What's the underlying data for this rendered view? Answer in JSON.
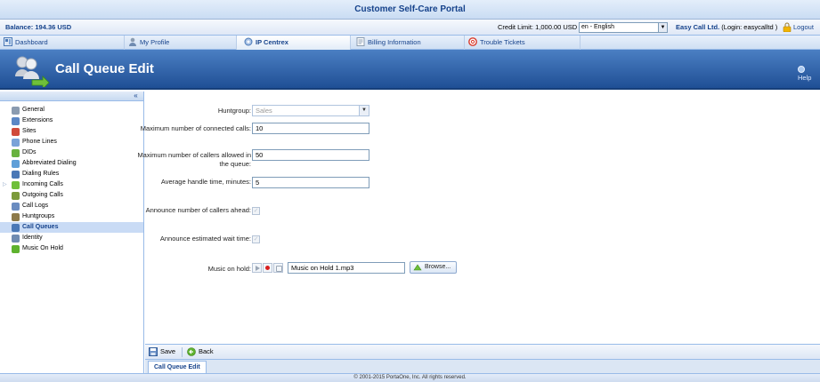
{
  "window": {
    "title": "Customer Self-Care Portal"
  },
  "status": {
    "balance": "Balance: 194.36 USD",
    "credit_limit_label": "Credit Limit:",
    "credit_limit_value": "1,000.00 USD",
    "language": "en - English",
    "company_name": "Easy Call Ltd.",
    "login": "(Login: easycalltd )",
    "logout": "Logout"
  },
  "tabs": [
    {
      "label": "Dashboard",
      "icon": "dashboard-icon",
      "active": false
    },
    {
      "label": "My Profile",
      "icon": "profile-icon",
      "active": false
    },
    {
      "label": "IP Centrex",
      "icon": "ip-centrex-icon",
      "active": true
    },
    {
      "label": "Billing Information",
      "icon": "billing-icon",
      "active": false
    },
    {
      "label": "Trouble Tickets",
      "icon": "lifebuoy-icon",
      "active": false
    }
  ],
  "page": {
    "title": "Call Queue Edit",
    "help": "Help"
  },
  "sidebar": {
    "items": [
      {
        "label": "General",
        "icon": "gear-icon",
        "selected": false,
        "expandable": false
      },
      {
        "label": "Extensions",
        "icon": "extensions-icon",
        "selected": false,
        "expandable": false
      },
      {
        "label": "Sites",
        "icon": "sites-icon",
        "selected": false,
        "expandable": false
      },
      {
        "label": "Phone Lines",
        "icon": "phone-lines-icon",
        "selected": false,
        "expandable": false
      },
      {
        "label": "DIDs",
        "icon": "dids-icon",
        "selected": false,
        "expandable": false
      },
      {
        "label": "Abbreviated Dialing",
        "icon": "abbreviated-dialing-icon",
        "selected": false,
        "expandable": false
      },
      {
        "label": "Dialing Rules",
        "icon": "dialing-rules-icon",
        "selected": false,
        "expandable": false
      },
      {
        "label": "Incoming Calls",
        "icon": "incoming-calls-icon",
        "selected": false,
        "expandable": true
      },
      {
        "label": "Outgoing Calls",
        "icon": "outgoing-calls-icon",
        "selected": false,
        "expandable": false
      },
      {
        "label": "Call Logs",
        "icon": "call-logs-icon",
        "selected": false,
        "expandable": false
      },
      {
        "label": "Huntgroups",
        "icon": "huntgroups-icon",
        "selected": false,
        "expandable": false
      },
      {
        "label": "Call Queues",
        "icon": "call-queues-icon",
        "selected": true,
        "expandable": false
      },
      {
        "label": "Identity",
        "icon": "identity-icon",
        "selected": false,
        "expandable": false
      },
      {
        "label": "Music On Hold",
        "icon": "music-on-hold-icon",
        "selected": false,
        "expandable": false
      }
    ]
  },
  "form": {
    "huntgroup": {
      "label": "Huntgroup:",
      "value": "Sales"
    },
    "max_connected": {
      "label": "Maximum number of connected calls:",
      "value": "10"
    },
    "max_callers": {
      "label": "Maximum number of callers allowed in the queue:",
      "value": "50"
    },
    "avg_handle": {
      "label": "Average handle time, minutes:",
      "value": "5"
    },
    "announce_ahead": {
      "label": "Announce number of callers ahead:",
      "checked": true
    },
    "announce_wait": {
      "label": "Announce estimated wait time:",
      "checked": true
    },
    "music_on_hold": {
      "label": "Music on hold:",
      "value": "Music on Hold 1.mp3",
      "browse": "Browse..."
    }
  },
  "toolbar": {
    "save": "Save",
    "back": "Back"
  },
  "bottom_tab": "Call Queue Edit",
  "footer": "© 2001-2015 PortaOne, Inc. All rights reserved.",
  "colors": {
    "header_blue": "#2a5ba3",
    "link_blue": "#15428b",
    "selected_row": "#c9dbf5",
    "record_red": "#d81e1e"
  }
}
